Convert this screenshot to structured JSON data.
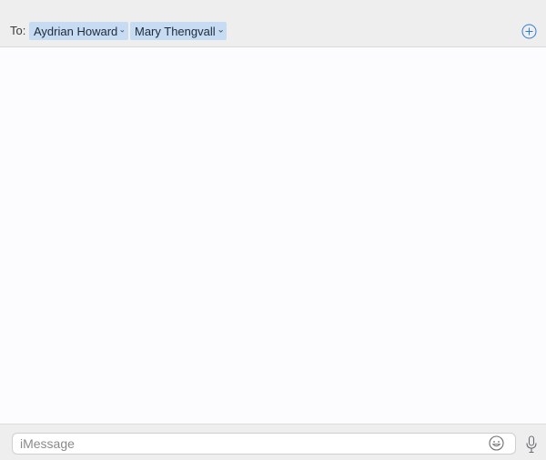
{
  "header": {
    "to_label": "To:",
    "recipients": [
      {
        "name": "Aydrian Howard"
      },
      {
        "name": "Mary Thengvall"
      }
    ],
    "add_icon": "plus-circle-icon"
  },
  "composer": {
    "placeholder": "iMessage",
    "value": "",
    "emoji_icon": "smiley-icon",
    "mic_icon": "microphone-icon"
  },
  "colors": {
    "chip_background": "#c7dcf2",
    "bar_background": "#efeeef",
    "accent_icon": "#2f7bd6"
  }
}
